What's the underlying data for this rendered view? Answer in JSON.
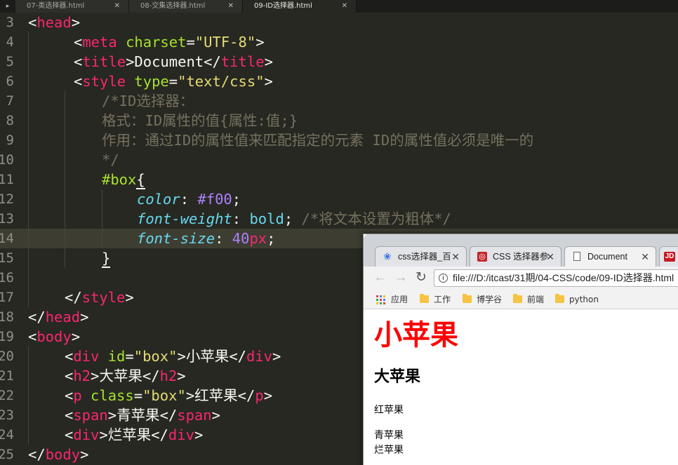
{
  "editor_tabs": [
    {
      "label": "07-类选择器.html",
      "close": "✕"
    },
    {
      "label": "08-交集选择器.html",
      "close": "✕"
    },
    {
      "label": "09-ID选择器.html",
      "close": "✕"
    }
  ],
  "editor_tab_scroll_icon": "▸",
  "code": {
    "line_numbers": [
      "3",
      "4",
      "5",
      "6",
      "7",
      "8",
      "9",
      "10",
      "11",
      "12",
      "13",
      "14",
      "15",
      "16",
      "17",
      "18",
      "19",
      "20",
      "21",
      "22",
      "23",
      "24",
      "25"
    ],
    "l3": {
      "o": "<",
      "tag": "head",
      "c": ">"
    },
    "l4": {
      "o": "<",
      "tag": "meta",
      "attr": "charset",
      "eq": "=",
      "val": "\"UTF-8\"",
      "c": ">"
    },
    "l5": {
      "o": "<",
      "tag": "title",
      "c": ">",
      "text": "Document",
      "o2": "</",
      "tag2": "title",
      "c2": ">"
    },
    "l6": {
      "o": "<",
      "tag": "style",
      "attr": "type",
      "eq": "=",
      "val": "\"text/css\"",
      "c": ">"
    },
    "l7": "/*ID选择器：",
    "l8": "格式：ID属性的值{属性:值;}",
    "l9": "作用：通过ID的属性值来匹配指定的元素 ID的属性值必须是唯一的",
    "l10": "*/",
    "l11": {
      "selector": "#box",
      "brace": "{"
    },
    "l12": {
      "prop": "color",
      "colon": ": ",
      "val": "#f00",
      "semi": ";"
    },
    "l13": {
      "prop": "font-weight",
      "colon": ": ",
      "val": "bold",
      "semi": "; ",
      "comment": "/*将文本设置为粗体*/"
    },
    "l14": {
      "prop": "font-size",
      "colon": ": ",
      "num": "40",
      "unit": "px",
      "semi": ";"
    },
    "l15": "}",
    "l17": {
      "o": "</",
      "tag": "style",
      "c": ">"
    },
    "l18": {
      "o": "</",
      "tag": "head",
      "c": ">"
    },
    "l19": {
      "o": "<",
      "tag": "body",
      "c": ">"
    },
    "l20": {
      "o": "<",
      "tag": "div",
      "attr": "id",
      "eq": "=",
      "val": "\"box\"",
      "c": ">",
      "text": "小苹果",
      "o2": "</",
      "tag2": "div",
      "c2": ">"
    },
    "l21": {
      "o": "<",
      "tag": "h2",
      "c": ">",
      "text": "大苹果",
      "o2": "</",
      "tag2": "h2",
      "c2": ">"
    },
    "l22": {
      "o": "<",
      "tag": "p",
      "attr": "class",
      "eq": "=",
      "val": "\"box\"",
      "c": ">",
      "text": "红苹果",
      "o2": "</",
      "tag2": "p",
      "c2": ">"
    },
    "l23": {
      "o": "<",
      "tag": "span",
      "c": ">",
      "text": "青苹果",
      "o2": "</",
      "tag2": "span",
      "c2": ">"
    },
    "l24": {
      "o": "<",
      "tag": "div",
      "c": ">",
      "text": "烂苹果",
      "o2": "</",
      "tag2": "div",
      "c2": ">"
    },
    "l25": {
      "o": "</",
      "tag": "body",
      "c": ">"
    }
  },
  "browser": {
    "tabs": [
      {
        "label": "css选择器_百",
        "icon": "paw-icon",
        "close": "✕"
      },
      {
        "label": "CSS 选择器参",
        "icon": "site-icon",
        "close": "✕"
      },
      {
        "label": "Document",
        "icon": "page-icon",
        "close": "✕"
      },
      {
        "label": "JD",
        "icon": "jd-icon"
      }
    ],
    "nav": {
      "back": "←",
      "forward": "→",
      "reload": "↻"
    },
    "url": "file:///D:/itcast/31期/04-CSS/code/09-ID选择器.html",
    "url_info": "i",
    "bookmarks": [
      "应用",
      "工作",
      "博学谷",
      "前端",
      "python"
    ],
    "page": {
      "box": "小苹果",
      "h2": "大苹果",
      "p": "红苹果",
      "span": "青苹果",
      "div": "烂苹果"
    }
  },
  "colors": {
    "editor_bg": "#272822",
    "tag": "#f92672",
    "attr": "#a6e22e",
    "string": "#e6db74",
    "comment": "#75715e",
    "property": "#66d9ef",
    "number": "#ae81ff",
    "box_text": "#ff0000"
  }
}
